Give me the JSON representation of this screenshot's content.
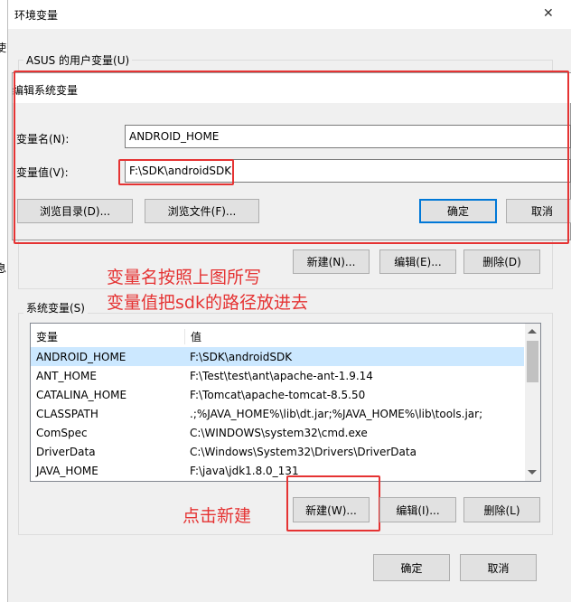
{
  "window": {
    "title": "环境变量",
    "close_glyph": "✕"
  },
  "user_vars": {
    "group_label": "ASUS 的用户变量(U)",
    "buttons": {
      "new": "新建(N)...",
      "edit": "编辑(E)...",
      "delete": "删除(D)"
    }
  },
  "edit_dialog": {
    "title": "编辑系统变量",
    "name_label": "变量名(N):",
    "name_value": "ANDROID_HOME",
    "value_label": "变量值(V):",
    "value_value": "F:\\SDK\\androidSDK",
    "buttons": {
      "browse_dir": "浏览目录(D)...",
      "browse_file": "浏览文件(F)...",
      "ok": "确定",
      "cancel": "取消"
    }
  },
  "annotations": {
    "line1": "变量名按照上图所写",
    "line2": "变量值把sdk的路径放进去",
    "click_new": "点击新建"
  },
  "system_vars": {
    "group_label": "系统变量(S)",
    "headers": [
      "变量",
      "值"
    ],
    "rows": [
      [
        "ANDROID_HOME",
        "F:\\SDK\\androidSDK"
      ],
      [
        "ANT_HOME",
        "F:\\Test\\test\\ant\\apache-ant-1.9.14"
      ],
      [
        "CATALINA_HOME",
        "F:\\Tomcat\\apache-tomcat-8.5.50"
      ],
      [
        "CLASSPATH",
        ".;%JAVA_HOME%\\lib\\dt.jar;%JAVA_HOME%\\lib\\tools.jar;"
      ],
      [
        "ComSpec",
        "C:\\WINDOWS\\system32\\cmd.exe"
      ],
      [
        "DriverData",
        "C:\\Windows\\System32\\Drivers\\DriverData"
      ],
      [
        "JAVA_HOME",
        "F:\\java\\jdk1.8.0_131"
      ]
    ],
    "buttons": {
      "new": "新建(W)...",
      "edit": "编辑(I)...",
      "delete": "删除(L)"
    }
  },
  "footer": {
    "ok": "确定",
    "cancel": "取消"
  },
  "left_fragments": {
    "a": "使",
    "b": "息"
  },
  "colors": {
    "annotation_red": "#e53333",
    "accent": "#0078d7",
    "selection": "#cce8ff"
  }
}
